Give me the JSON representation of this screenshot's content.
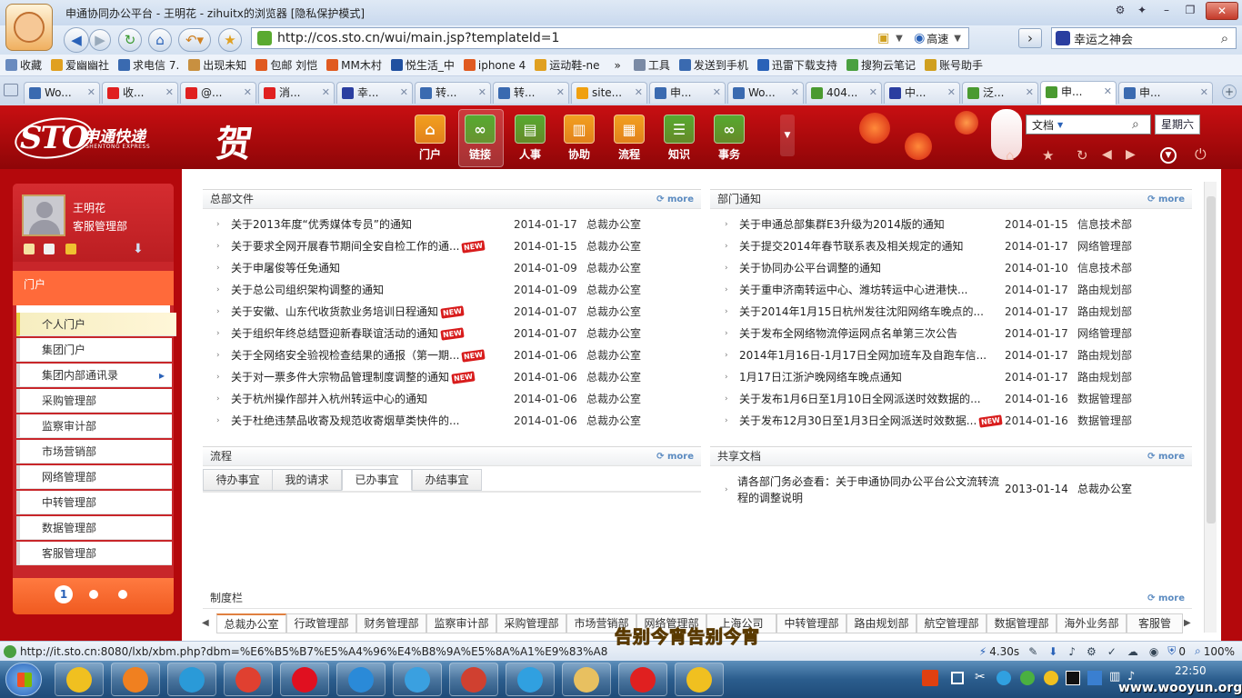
{
  "window": {
    "title": "申通协同办公平台 - 王明花 - zihuitx的浏览器 [隐私保护模式]"
  },
  "nav": {
    "url": "http://cos.sto.cn/wui/main.jsp?templateId=1",
    "speed_label": "高速",
    "search_value": "幸运之神会"
  },
  "favorites": [
    {
      "label": "收藏",
      "color": "#6a8bbf"
    },
    {
      "label": "爱幽幽社",
      "color": "#e0a020"
    },
    {
      "label": "求电信 7.",
      "color": "#3a6ab0"
    },
    {
      "label": "出现未知",
      "color": "#c89040"
    },
    {
      "label": "包邮 刘恺",
      "color": "#e05a20"
    },
    {
      "label": "MM木村",
      "color": "#e05a20"
    },
    {
      "label": "悦生活_中",
      "color": "#2050a0"
    },
    {
      "label": "iphone 4",
      "color": "#e05a20"
    },
    {
      "label": "运动鞋-ne",
      "color": "#e0a020"
    },
    {
      "label": "»",
      "color": ""
    },
    {
      "label": "工具",
      "color": "#7a8aa5"
    },
    {
      "label": "发送到手机",
      "color": "#3a6ab0"
    },
    {
      "label": "迅雷下载支持",
      "color": "#2a62b8"
    },
    {
      "label": "搜狗云笔记",
      "color": "#4aa040"
    },
    {
      "label": "账号助手",
      "color": "#d0a020"
    }
  ],
  "tabs": [
    {
      "label": "Wo...",
      "color": "#3a6ab0"
    },
    {
      "label": "收...",
      "color": "#e02020"
    },
    {
      "label": "@...",
      "color": "#e02020"
    },
    {
      "label": "消...",
      "color": "#e02020"
    },
    {
      "label": "幸...",
      "color": "#2a3ea0"
    },
    {
      "label": "转...",
      "color": "#3a6ab0"
    },
    {
      "label": "转...",
      "color": "#3a6ab0"
    },
    {
      "label": "site...",
      "color": "#f0a010"
    },
    {
      "label": "申...",
      "color": "#3a6ab0"
    },
    {
      "label": "Wo...",
      "color": "#3a6ab0"
    },
    {
      "label": "404...",
      "color": "#4a9a30"
    },
    {
      "label": "中...",
      "color": "#2a3ea0"
    },
    {
      "label": "泛...",
      "color": "#4a9a30"
    },
    {
      "label": "申...",
      "color": "#4a9a30"
    },
    {
      "label": "申...",
      "color": "#3a6ab0"
    }
  ],
  "header": {
    "logo": "STO",
    "logo_cn": "申通快递",
    "logo_en": "SHENTONG EXPRESS",
    "greeting": "贺",
    "nav": [
      {
        "label": "门户",
        "color": "#f0a020",
        "glyph": "⌂"
      },
      {
        "label": "链接",
        "color": "#55aa30",
        "glyph": "∞"
      },
      {
        "label": "人事",
        "color": "#55aa30",
        "glyph": "▤"
      },
      {
        "label": "协助",
        "color": "#f0a020",
        "glyph": "▥"
      },
      {
        "label": "流程",
        "color": "#f0a020",
        "glyph": "▦"
      },
      {
        "label": "知识",
        "color": "#55aa30",
        "glyph": "☰"
      },
      {
        "label": "事务",
        "color": "#55aa30",
        "glyph": "∞"
      }
    ],
    "search_type": "文档",
    "weekday": "星期六"
  },
  "sidebar": {
    "user_name": "王明花",
    "user_dept": "客服管理部",
    "section": "门户",
    "items": [
      "个人门户",
      "集团门户",
      "集团内部通讯录",
      "采购管理部",
      "监察审计部",
      "市场营销部",
      "网络管理部",
      "中转管理部",
      "数据管理部",
      "客服管理部"
    ],
    "page_current": "1"
  },
  "panels": {
    "hq_docs": {
      "title": "总部文件",
      "more": "more",
      "rows": [
        {
          "title": "关于2013年度“优秀媒体专员”的通知",
          "date": "2014-01-17",
          "dept": "总裁办公室",
          "new": false
        },
        {
          "title": "关于要求全网开展春节期间全安自检工作的通...",
          "date": "2014-01-15",
          "dept": "总裁办公室",
          "new": true
        },
        {
          "title": "关于申屠俊等任免通知",
          "date": "2014-01-09",
          "dept": "总裁办公室",
          "new": false
        },
        {
          "title": "关于总公司组织架构调整的通知",
          "date": "2014-01-09",
          "dept": "总裁办公室",
          "new": false
        },
        {
          "title": "关于安徽、山东代收货款业务培训日程通知",
          "date": "2014-01-07",
          "dept": "总裁办公室",
          "new": true
        },
        {
          "title": "关于组织年终总结暨迎新春联谊活动的通知",
          "date": "2014-01-07",
          "dept": "总裁办公室",
          "new": true
        },
        {
          "title": "关于全网络安全验视检查结果的通报（第一期...",
          "date": "2014-01-06",
          "dept": "总裁办公室",
          "new": true
        },
        {
          "title": "关于对一票多件大宗物品管理制度调整的通知",
          "date": "2014-01-06",
          "dept": "总裁办公室",
          "new": true
        },
        {
          "title": "关于杭州操作部并入杭州转运中心的通知",
          "date": "2014-01-06",
          "dept": "总裁办公室",
          "new": false
        },
        {
          "title": "关于杜绝违禁品收寄及规范收寄烟草类快件的...",
          "date": "2014-01-06",
          "dept": "总裁办公室",
          "new": false
        }
      ]
    },
    "dept_notices": {
      "title": "部门通知",
      "more": "more",
      "rows": [
        {
          "title": "关于申通总部集群E3升级为2014版的通知",
          "date": "2014-01-15",
          "dept": "信息技术部",
          "new": false
        },
        {
          "title": "关于提交2014年春节联系表及相关规定的通知",
          "date": "2014-01-17",
          "dept": "网络管理部",
          "new": false
        },
        {
          "title": "关于协同办公平台调整的通知",
          "date": "2014-01-10",
          "dept": "信息技术部",
          "new": false
        },
        {
          "title": "关于重申济南转运中心、潍坊转运中心进港快...",
          "date": "2014-01-17",
          "dept": "路由规划部",
          "new": false
        },
        {
          "title": "关于2014年1月15日杭州发往沈阳网络车晚点的...",
          "date": "2014-01-17",
          "dept": "路由规划部",
          "new": false
        },
        {
          "title": "关于发布全网络物流停运网点名单第三次公告",
          "date": "2014-01-17",
          "dept": "网络管理部",
          "new": false
        },
        {
          "title": "2014年1月16日-1月17日全网加班车及自跑车信...",
          "date": "2014-01-17",
          "dept": "路由规划部",
          "new": false
        },
        {
          "title": "1月17日江浙沪晚网络车晚点通知",
          "date": "2014-01-17",
          "dept": "路由规划部",
          "new": false
        },
        {
          "title": "关于发布1月6日至1月10日全网派送时效数据的...",
          "date": "2014-01-16",
          "dept": "数据管理部",
          "new": false
        },
        {
          "title": "关于发布12月30日至1月3日全网派送时效数据...",
          "date": "2014-01-16",
          "dept": "数据管理部",
          "new": true
        }
      ]
    },
    "flow": {
      "title": "流程",
      "more": "more",
      "tabs": [
        "待办事宜",
        "我的请求",
        "已办事宜",
        "办结事宜"
      ],
      "active_tab": 2
    },
    "shared_docs": {
      "title": "共享文档",
      "more": "more",
      "rows": [
        {
          "title_line1": "请各部门务必查看：关于申通协同办公平台公文流转流",
          "title_line2": "程的调整说明",
          "date": "2013-01-14",
          "dept": "总裁办公室"
        }
      ]
    },
    "systems": {
      "title": "制度栏",
      "more": "more",
      "tabs": [
        "总裁办公室",
        "行政管理部",
        "财务管理部",
        "监察审计部",
        "采购管理部",
        "市场营销部",
        "网络管理部",
        "上海公司",
        "中转管理部",
        "路由规划部",
        "航空管理部",
        "数据管理部",
        "海外业务部",
        "客服管"
      ],
      "active_tab": 0
    }
  },
  "overlay_text": "告别今宵告别今宵",
  "status": {
    "url": "http://it.sto.cn:8080/lxb/xbm.php?dbm=%E6%B5%B7%E5%A4%96%E4%B8%9A%E5%8A%A1%E9%83%A8",
    "time": "4.30s",
    "count": "0",
    "zoom": "100%"
  },
  "taskbar": {
    "apps": [
      {
        "name": "start",
        "color": "#3a7fd0"
      },
      {
        "name": "app-1",
        "color": "#f0c020"
      },
      {
        "name": "app-2",
        "color": "#f08020"
      },
      {
        "name": "app-3",
        "color": "#2a9ad8"
      },
      {
        "name": "chrome",
        "color": "#e04030"
      },
      {
        "name": "opera",
        "color": "#e01020"
      },
      {
        "name": "app-6",
        "color": "#2a8ad8"
      },
      {
        "name": "app-7",
        "color": "#3aa0e0"
      },
      {
        "name": "app-8",
        "color": "#d04030"
      },
      {
        "name": "app-9",
        "color": "#30a0e0"
      },
      {
        "name": "folder",
        "color": "#e8c060"
      },
      {
        "name": "app-11",
        "color": "#e02020"
      },
      {
        "name": "qq",
        "color": "#f0c020"
      }
    ],
    "clock_time": "22:50",
    "watermark": "www.wooyun.org"
  }
}
